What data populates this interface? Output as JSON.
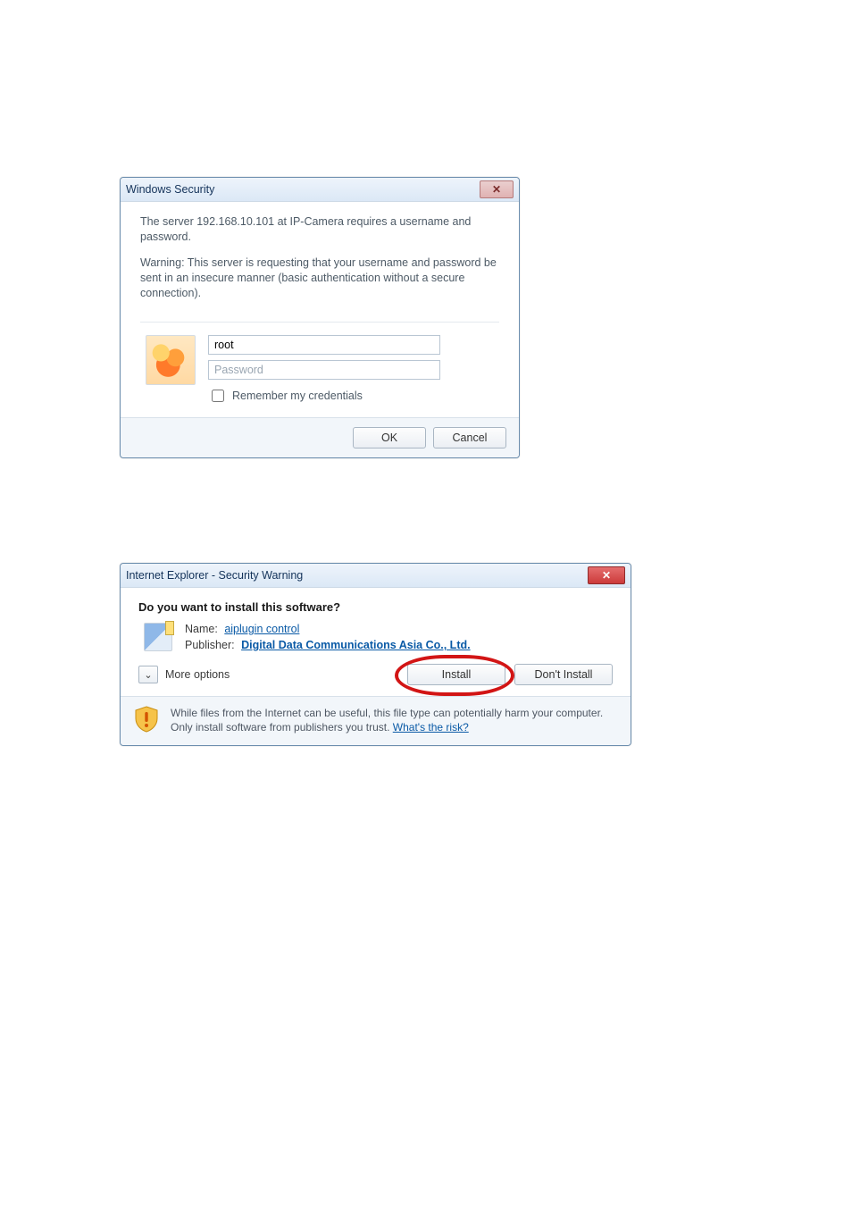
{
  "dialog1": {
    "title": "Windows Security",
    "close_glyph": "✕",
    "para1": "The server 192.168.10.101 at IP-Camera requires a username and password.",
    "para2": "Warning: This server is requesting that your username and password be sent in an insecure manner (basic authentication without a secure connection).",
    "username_value": "root",
    "password_placeholder": "Password",
    "remember_label": "Remember my credentials",
    "ok_label": "OK",
    "cancel_label": "Cancel"
  },
  "dialog2": {
    "title": "Internet Explorer - Security Warning",
    "close_glyph": "✕",
    "question": "Do you want to install this software?",
    "name_label": "Name:",
    "name_link": "aiplugin control",
    "publisher_label": "Publisher:",
    "publisher_link": "Digital Data Communications Asia Co., Ltd.",
    "chevron_glyph": "⌄",
    "more_options": "More options",
    "install_label": "Install",
    "dont_install_label": "Don't Install",
    "footer_text_1": "While files from the Internet can be useful, this file type can potentially harm your computer. Only install software from publishers you trust. ",
    "risk_link": "What's the risk?"
  }
}
